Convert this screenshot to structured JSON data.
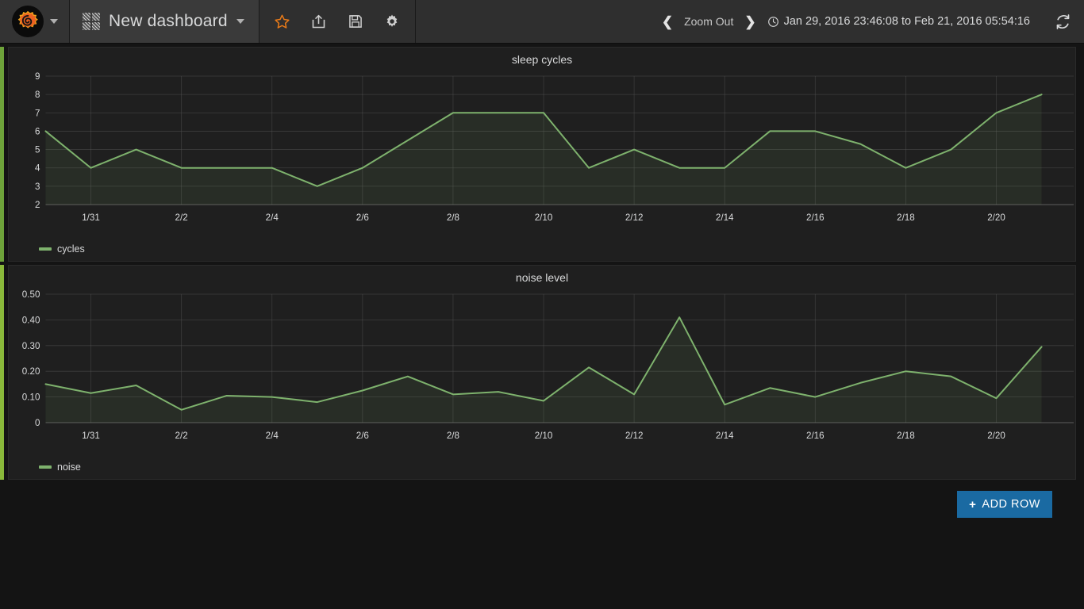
{
  "navbar": {
    "logo_icon": "grafana-logo-icon",
    "logo_caret_icon": "chevron-down-icon",
    "dashboard_icon": "dashboard-grid-icon",
    "dashboard_title": "New dashboard",
    "dashboard_caret_icon": "chevron-down-icon",
    "actions": [
      {
        "name": "star-icon",
        "label": "Mark as favorite"
      },
      {
        "name": "share-icon",
        "label": "Share dashboard"
      },
      {
        "name": "save-icon",
        "label": "Save dashboard"
      },
      {
        "name": "gear-icon",
        "label": "Dashboard settings"
      }
    ],
    "zoom_out_label": "Zoom Out",
    "prev_arrow_icon": "chevron-left-icon",
    "next_arrow_icon": "chevron-right-icon",
    "clock_icon": "clock-icon",
    "time_range": "Jan 29, 2016 23:46:08 to Feb 21, 2016 05:54:16",
    "refresh_icon": "refresh-icon",
    "accent_color": "#eb7b18",
    "brand_blue": "#1a6aa2"
  },
  "footer": {
    "add_row_label": "ADD ROW",
    "add_row_plus": "+"
  },
  "chart_data": [
    {
      "type": "line",
      "title": "sleep cycles",
      "legend": [
        "cycles"
      ],
      "series_color": "#7eb26d",
      "fill_color": "rgba(126,178,109,0.10)",
      "xlabel": "",
      "ylabel": "",
      "ylim": [
        2,
        9
      ],
      "yticks": [
        2,
        3,
        4,
        5,
        6,
        7,
        8,
        9
      ],
      "ytick_labels": [
        "2",
        "3",
        "4",
        "5",
        "6",
        "7",
        "8",
        "9"
      ],
      "xticks": [
        "1/31",
        "2/2",
        "2/4",
        "2/6",
        "2/8",
        "2/10",
        "2/12",
        "2/14",
        "2/16",
        "2/18",
        "2/20"
      ],
      "grid": true,
      "legend_position": "bottom-left",
      "x": [
        "1/30",
        "1/31",
        "2/1",
        "2/2",
        "2/3",
        "2/4",
        "2/5",
        "2/6",
        "2/7",
        "2/8",
        "2/9",
        "2/10",
        "2/11",
        "2/12",
        "2/13",
        "2/14",
        "2/15",
        "2/16",
        "2/17",
        "2/18",
        "2/19",
        "2/20",
        "2/21"
      ],
      "values": [
        6,
        4,
        5,
        4,
        4,
        4,
        3,
        4,
        5.5,
        7,
        7,
        7,
        4,
        5,
        4,
        4,
        6,
        6,
        5.3,
        4,
        5,
        7,
        8
      ]
    },
    {
      "type": "line",
      "title": "noise level",
      "legend": [
        "noise"
      ],
      "series_color": "#7eb26d",
      "fill_color": "rgba(126,178,109,0.10)",
      "xlabel": "",
      "ylabel": "",
      "ylim": [
        0,
        0.5
      ],
      "yticks": [
        0,
        0.1,
        0.2,
        0.3,
        0.4,
        0.5
      ],
      "ytick_labels": [
        "0",
        "0.10",
        "0.20",
        "0.30",
        "0.40",
        "0.50"
      ],
      "xticks": [
        "1/31",
        "2/2",
        "2/4",
        "2/6",
        "2/8",
        "2/10",
        "2/12",
        "2/14",
        "2/16",
        "2/18",
        "2/20"
      ],
      "grid": true,
      "legend_position": "bottom-left",
      "x": [
        "1/30",
        "1/31",
        "2/1",
        "2/2",
        "2/3",
        "2/4",
        "2/5",
        "2/6",
        "2/7",
        "2/8",
        "2/9",
        "2/10",
        "2/11",
        "2/12",
        "2/13",
        "2/14",
        "2/15",
        "2/16",
        "2/17",
        "2/18",
        "2/19",
        "2/20",
        "2/21"
      ],
      "values": [
        0.15,
        0.115,
        0.145,
        0.05,
        0.105,
        0.1,
        0.08,
        0.125,
        0.18,
        0.11,
        0.12,
        0.085,
        0.215,
        0.11,
        0.41,
        0.07,
        0.135,
        0.1,
        0.155,
        0.2,
        0.18,
        0.095,
        0.295
      ]
    }
  ]
}
